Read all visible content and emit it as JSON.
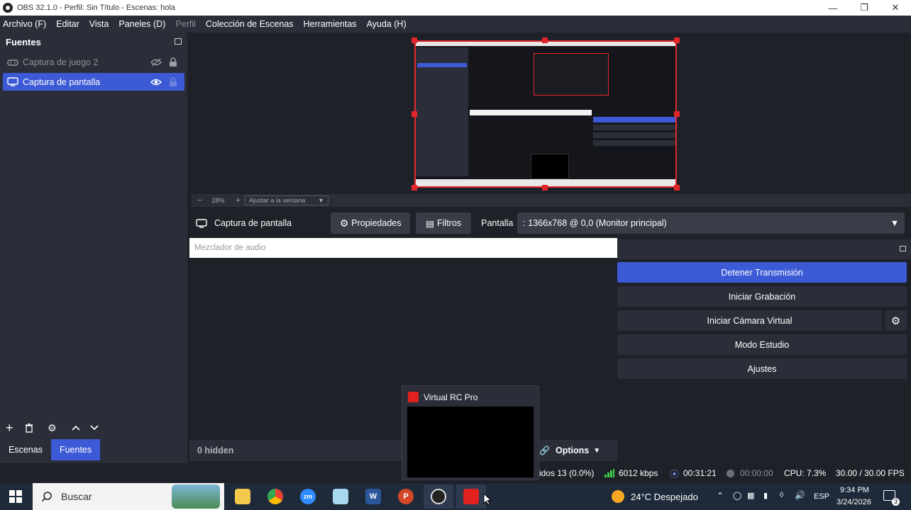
{
  "window": {
    "title": "OBS 32.1.0 - Perfil: Sin Título - Escenas: hola"
  },
  "menu": [
    "Archivo (F)",
    "Editar",
    "Vista",
    "Paneles (D)",
    "Perfil",
    "Colección de Escenas",
    "Herramientas",
    "Ayuda (H)"
  ],
  "sources": {
    "title": "Fuentes",
    "items": [
      {
        "label": "Captura de juego 2",
        "visible": false,
        "selected": false
      },
      {
        "label": "Captura de pantalla",
        "visible": true,
        "selected": true
      }
    ]
  },
  "zoom": {
    "level": "28%",
    "fit_label": "Ajustar a la ventana"
  },
  "properties_bar": {
    "source_name": "Captura de pantalla",
    "properties_label": "Propiedades",
    "filters_label": "Filtros",
    "screen_label": "Pantalla",
    "screen_value": ": 1366x768 @ 0,0 (Monitor principal)"
  },
  "mixer": {
    "title": "Mezclador de audio",
    "hidden_label": "0 hidden",
    "options_label": "Options"
  },
  "controls": {
    "stop_stream": "Detener Transmisión",
    "start_recording": "Iniciar Grabación",
    "start_virtualcam": "Iniciar Cámara Virtual",
    "studio_mode": "Modo Estudio",
    "settings": "Ajustes"
  },
  "tabs": {
    "scenes": "Escenas",
    "sources": "Fuentes"
  },
  "popup": {
    "title": "Virtual RC Pro"
  },
  "status": {
    "dropped": "idos 13 (0.0%)",
    "bitrate": "6012 kbps",
    "stream_time": "00:31:21",
    "rec_time": "00:00:00",
    "cpu": "CPU: 7.3%",
    "fps": "30.00 / 30.00 FPS"
  },
  "taskbar": {
    "search_placeholder": "Buscar",
    "weather": "24°C  Despejado",
    "lang": "ESP",
    "time": "9:34 PM",
    "date": "3/24/2026",
    "notifications": "3"
  },
  "colors": {
    "accent": "#3c5ad6",
    "selection": "#e3262a",
    "panel": "#2b2e38",
    "bg": "#1f2128"
  }
}
